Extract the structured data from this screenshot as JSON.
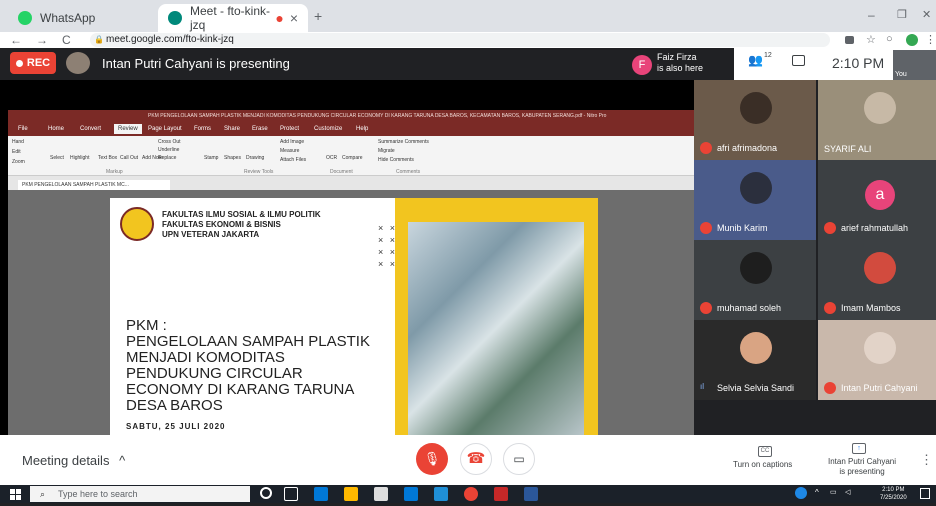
{
  "browser": {
    "tabs": [
      {
        "label": "WhatsApp",
        "icon": "whatsapp-icon",
        "color": "#25d366"
      },
      {
        "label": "Meet - fto-kink-jzq",
        "icon": "meet-icon",
        "color": "#00897b"
      }
    ],
    "url": "meet.google.com/fto-kink-jzq",
    "new_tab": "+",
    "window_controls": [
      "–",
      "❐",
      "✕"
    ],
    "nav": {
      "back": "←",
      "forward": "→",
      "reload": "C"
    }
  },
  "meet_top": {
    "rec_label": "REC",
    "presenting_title": "Intan Putri Cahyani is presenting",
    "also_presenting": {
      "avatar_letter": "F",
      "text_line1": "Faiz Firza",
      "text_line2": "is also here"
    },
    "people_count": "12",
    "time": "2:10 PM",
    "you_label": "You"
  },
  "pdf_viewer": {
    "title": "PKM PENGELOLAAN SAMPAH PLASTIK MENJADI KOMODITAS PENDUKUNG CIRCULAR ECONOMY DI KARANG TARUNA DESA BAROS, KECAMATAN BAROS, KABUPATEN SERANG.pdf - Nitro Pro",
    "menu": [
      "File",
      "Home",
      "Convert",
      "Review",
      "Page Layout",
      "Forms",
      "Share",
      "Erase",
      "Protect",
      "Customize",
      "Help"
    ],
    "ribbon_groups": [
      "Markup",
      "Review Tools",
      "Document",
      "Comments"
    ],
    "ribbon_buttons": [
      "Hand",
      "Edit",
      "Zoom",
      "Select",
      "Highlight",
      "Text Box",
      "Call Out",
      "Add Note",
      "Cross Out",
      "Underline",
      "Replace",
      "Stamp",
      "Shapes",
      "Drawing",
      "Add Image",
      "Measure",
      "Attach Files",
      "OCR",
      "Compare",
      "Summarize Comments",
      "Migrate",
      "Hide Comments"
    ],
    "doc_tab": "PKM PENGELOLAAN SAMPAH PLASTIK MC..."
  },
  "slide": {
    "faculty_lines": [
      "FAKULTAS ILMU SOSIAL & ILMU POLITIK",
      "FAKULTAS EKONOMI & BISNIS",
      "UPN VETERAN JAKARTA"
    ],
    "x_marks": [
      "× ×",
      "× ×",
      "× ×",
      "× ×"
    ],
    "pkm": "PKM :",
    "title_lines": [
      "PENGELOLAAN SAMPAH PLASTIK",
      "MENJADI KOMODITAS",
      "PENDUKUNG CIRCULAR",
      "ECONOMY DI KARANG TARUNA",
      "DESA BAROS"
    ],
    "date": "SABTU, 25 JULI 2020"
  },
  "participants": [
    {
      "name": "afri afrimadona",
      "mic": "off",
      "avatar": "photo",
      "bg": "#6b5a4a"
    },
    {
      "name": "SYARIF ALI",
      "mic": "none",
      "avatar": "photo",
      "bg": "#9a8f7a"
    },
    {
      "name": "Munib Karim",
      "mic": "off",
      "avatar": "photo",
      "bg": "#4a5b8a"
    },
    {
      "name": "arief rahmatullah",
      "mic": "off",
      "avatar": "a",
      "bg": "#3c4043"
    },
    {
      "name": "muhamad soleh",
      "mic": "off",
      "avatar": "photo",
      "bg": "#3c4043"
    },
    {
      "name": "Imam Mambos",
      "mic": "off",
      "avatar": "photo",
      "bg": "#3c4043"
    },
    {
      "name": "Selvia Selvia Sandi",
      "mic": "on",
      "avatar": "photo",
      "bg": "#2a2a2a"
    },
    {
      "name": "Intan Putri Cahyani",
      "mic": "off",
      "avatar": "photo",
      "bg": "#c9b8ab"
    }
  ],
  "bottom": {
    "meeting_details": "Meeting details",
    "chevron": "^",
    "turn_on_captions": "Turn on captions",
    "cc_icon": "CC",
    "presenting_line1": "Intan Putri Cahyani",
    "presenting_line2": "is presenting",
    "more": "⋮"
  },
  "taskbar": {
    "search_placeholder": "Type here to search",
    "time": "2:10 PM",
    "date": "7/25/2020"
  }
}
